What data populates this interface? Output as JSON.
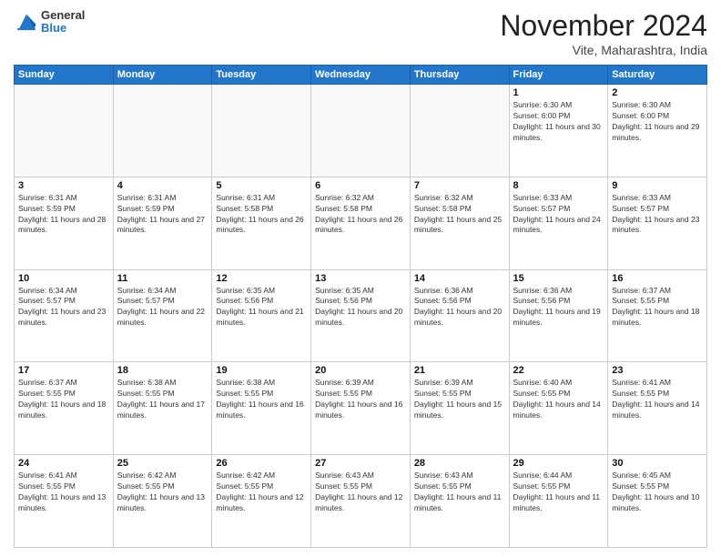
{
  "header": {
    "logo": {
      "general": "General",
      "blue": "Blue"
    },
    "month": "November 2024",
    "location": "Vite, Maharashtra, India"
  },
  "weekdays": [
    "Sunday",
    "Monday",
    "Tuesday",
    "Wednesday",
    "Thursday",
    "Friday",
    "Saturday"
  ],
  "weeks": [
    [
      {
        "day": "",
        "empty": true
      },
      {
        "day": "",
        "empty": true
      },
      {
        "day": "",
        "empty": true
      },
      {
        "day": "",
        "empty": true
      },
      {
        "day": "",
        "empty": true
      },
      {
        "day": "1",
        "sunrise": "6:30 AM",
        "sunset": "6:00 PM",
        "daylight": "11 hours and 30 minutes."
      },
      {
        "day": "2",
        "sunrise": "6:30 AM",
        "sunset": "6:00 PM",
        "daylight": "11 hours and 29 minutes."
      }
    ],
    [
      {
        "day": "3",
        "sunrise": "6:31 AM",
        "sunset": "5:59 PM",
        "daylight": "11 hours and 28 minutes."
      },
      {
        "day": "4",
        "sunrise": "6:31 AM",
        "sunset": "5:59 PM",
        "daylight": "11 hours and 27 minutes."
      },
      {
        "day": "5",
        "sunrise": "6:31 AM",
        "sunset": "5:58 PM",
        "daylight": "11 hours and 26 minutes."
      },
      {
        "day": "6",
        "sunrise": "6:32 AM",
        "sunset": "5:58 PM",
        "daylight": "11 hours and 26 minutes."
      },
      {
        "day": "7",
        "sunrise": "6:32 AM",
        "sunset": "5:58 PM",
        "daylight": "11 hours and 25 minutes."
      },
      {
        "day": "8",
        "sunrise": "6:33 AM",
        "sunset": "5:57 PM",
        "daylight": "11 hours and 24 minutes."
      },
      {
        "day": "9",
        "sunrise": "6:33 AM",
        "sunset": "5:57 PM",
        "daylight": "11 hours and 23 minutes."
      }
    ],
    [
      {
        "day": "10",
        "sunrise": "6:34 AM",
        "sunset": "5:57 PM",
        "daylight": "11 hours and 23 minutes."
      },
      {
        "day": "11",
        "sunrise": "6:34 AM",
        "sunset": "5:57 PM",
        "daylight": "11 hours and 22 minutes."
      },
      {
        "day": "12",
        "sunrise": "6:35 AM",
        "sunset": "5:56 PM",
        "daylight": "11 hours and 21 minutes."
      },
      {
        "day": "13",
        "sunrise": "6:35 AM",
        "sunset": "5:56 PM",
        "daylight": "11 hours and 20 minutes."
      },
      {
        "day": "14",
        "sunrise": "6:36 AM",
        "sunset": "5:56 PM",
        "daylight": "11 hours and 20 minutes."
      },
      {
        "day": "15",
        "sunrise": "6:36 AM",
        "sunset": "5:56 PM",
        "daylight": "11 hours and 19 minutes."
      },
      {
        "day": "16",
        "sunrise": "6:37 AM",
        "sunset": "5:55 PM",
        "daylight": "11 hours and 18 minutes."
      }
    ],
    [
      {
        "day": "17",
        "sunrise": "6:37 AM",
        "sunset": "5:55 PM",
        "daylight": "11 hours and 18 minutes."
      },
      {
        "day": "18",
        "sunrise": "6:38 AM",
        "sunset": "5:55 PM",
        "daylight": "11 hours and 17 minutes."
      },
      {
        "day": "19",
        "sunrise": "6:38 AM",
        "sunset": "5:55 PM",
        "daylight": "11 hours and 16 minutes."
      },
      {
        "day": "20",
        "sunrise": "6:39 AM",
        "sunset": "5:55 PM",
        "daylight": "11 hours and 16 minutes."
      },
      {
        "day": "21",
        "sunrise": "6:39 AM",
        "sunset": "5:55 PM",
        "daylight": "11 hours and 15 minutes."
      },
      {
        "day": "22",
        "sunrise": "6:40 AM",
        "sunset": "5:55 PM",
        "daylight": "11 hours and 14 minutes."
      },
      {
        "day": "23",
        "sunrise": "6:41 AM",
        "sunset": "5:55 PM",
        "daylight": "11 hours and 14 minutes."
      }
    ],
    [
      {
        "day": "24",
        "sunrise": "6:41 AM",
        "sunset": "5:55 PM",
        "daylight": "11 hours and 13 minutes."
      },
      {
        "day": "25",
        "sunrise": "6:42 AM",
        "sunset": "5:55 PM",
        "daylight": "11 hours and 13 minutes."
      },
      {
        "day": "26",
        "sunrise": "6:42 AM",
        "sunset": "5:55 PM",
        "daylight": "11 hours and 12 minutes."
      },
      {
        "day": "27",
        "sunrise": "6:43 AM",
        "sunset": "5:55 PM",
        "daylight": "11 hours and 12 minutes."
      },
      {
        "day": "28",
        "sunrise": "6:43 AM",
        "sunset": "5:55 PM",
        "daylight": "11 hours and 11 minutes."
      },
      {
        "day": "29",
        "sunrise": "6:44 AM",
        "sunset": "5:55 PM",
        "daylight": "11 hours and 11 minutes."
      },
      {
        "day": "30",
        "sunrise": "6:45 AM",
        "sunset": "5:55 PM",
        "daylight": "11 hours and 10 minutes."
      }
    ]
  ]
}
